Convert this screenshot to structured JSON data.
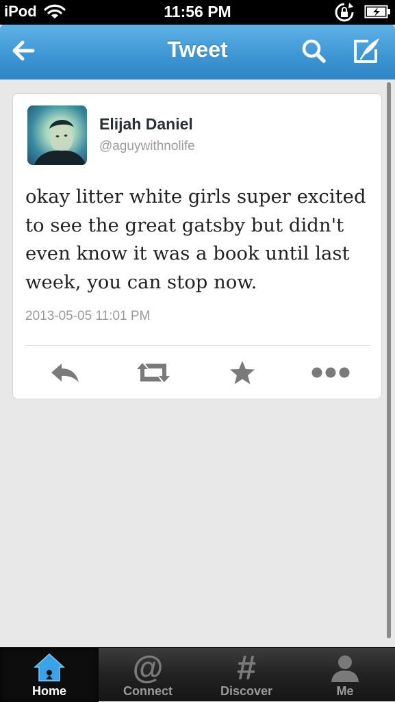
{
  "status_bar": {
    "carrier": "iPod",
    "time": "11:56 PM"
  },
  "nav": {
    "title": "Tweet"
  },
  "tweet": {
    "author_name": "Elijah Daniel",
    "author_handle": "@aguywithnolife",
    "text": "okay litter white girls super excited to see the great gatsby but didn't even know it was a book until last week, you can stop now.",
    "timestamp": "2013-05-05 11:01 PM"
  },
  "actions": {
    "icons": [
      "reply-icon",
      "retweet-icon",
      "favorite-star-icon",
      "more-dots-icon"
    ]
  },
  "tabs": [
    {
      "label": "Home",
      "icon": "home-icon",
      "active": true
    },
    {
      "label": "Connect",
      "icon": "at-sign-icon",
      "active": false
    },
    {
      "label": "Discover",
      "icon": "hash-icon",
      "active": false
    },
    {
      "label": "Me",
      "icon": "person-icon",
      "active": false
    }
  ],
  "colors": {
    "nav_blue": "#3f97d4",
    "tab_active_blue": "#3aa3e8",
    "icon_gray": "#7a7a7a"
  }
}
